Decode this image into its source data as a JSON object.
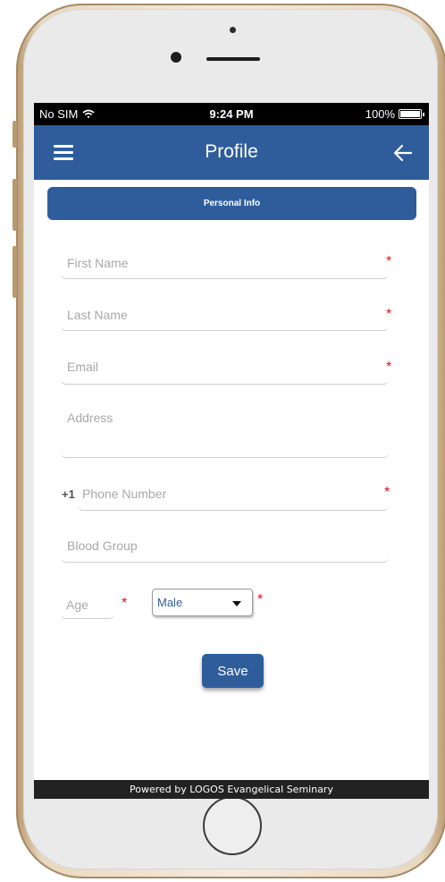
{
  "status_bar": {
    "carrier": "No SIM",
    "time": "9:24 PM",
    "battery": "100%",
    "battery_level": 1.0
  },
  "nav": {
    "title": "Profile",
    "menu_icon": "hamburger-menu-icon",
    "back_icon": "arrow-left-icon"
  },
  "section": {
    "title": "Personal Info"
  },
  "form": {
    "first_name": {
      "placeholder": "First Name",
      "value": "",
      "required": true
    },
    "last_name": {
      "placeholder": "Last Name",
      "value": "",
      "required": true
    },
    "email": {
      "placeholder": "Email",
      "value": "",
      "required": true
    },
    "address": {
      "placeholder": "Address",
      "value": ""
    },
    "phone": {
      "country_code": "+1",
      "placeholder": "Phone Number",
      "value": "",
      "required": true
    },
    "blood_group": {
      "placeholder": "Blood Group",
      "value": ""
    },
    "age": {
      "placeholder": "Age",
      "value": "",
      "required": true
    },
    "gender": {
      "selected": "Male",
      "required": true
    },
    "save_label": "Save"
  },
  "footer": {
    "text": "Powered by LOGOS Evangelical Seminary"
  },
  "colors": {
    "primary": "#2f5d9c",
    "required": "#e0101c",
    "status_bar": "#000000",
    "footer": "#222222"
  }
}
